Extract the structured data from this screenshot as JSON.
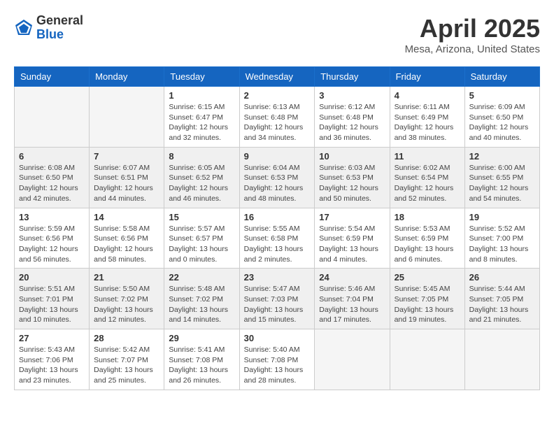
{
  "logo": {
    "general": "General",
    "blue": "Blue"
  },
  "header": {
    "title": "April 2025",
    "location": "Mesa, Arizona, United States"
  },
  "weekdays": [
    "Sunday",
    "Monday",
    "Tuesday",
    "Wednesday",
    "Thursday",
    "Friday",
    "Saturday"
  ],
  "weeks": [
    [
      {
        "day": "",
        "info": ""
      },
      {
        "day": "",
        "info": ""
      },
      {
        "day": "1",
        "info": "Sunrise: 6:15 AM\nSunset: 6:47 PM\nDaylight: 12 hours\nand 32 minutes."
      },
      {
        "day": "2",
        "info": "Sunrise: 6:13 AM\nSunset: 6:48 PM\nDaylight: 12 hours\nand 34 minutes."
      },
      {
        "day": "3",
        "info": "Sunrise: 6:12 AM\nSunset: 6:48 PM\nDaylight: 12 hours\nand 36 minutes."
      },
      {
        "day": "4",
        "info": "Sunrise: 6:11 AM\nSunset: 6:49 PM\nDaylight: 12 hours\nand 38 minutes."
      },
      {
        "day": "5",
        "info": "Sunrise: 6:09 AM\nSunset: 6:50 PM\nDaylight: 12 hours\nand 40 minutes."
      }
    ],
    [
      {
        "day": "6",
        "info": "Sunrise: 6:08 AM\nSunset: 6:50 PM\nDaylight: 12 hours\nand 42 minutes."
      },
      {
        "day": "7",
        "info": "Sunrise: 6:07 AM\nSunset: 6:51 PM\nDaylight: 12 hours\nand 44 minutes."
      },
      {
        "day": "8",
        "info": "Sunrise: 6:05 AM\nSunset: 6:52 PM\nDaylight: 12 hours\nand 46 minutes."
      },
      {
        "day": "9",
        "info": "Sunrise: 6:04 AM\nSunset: 6:53 PM\nDaylight: 12 hours\nand 48 minutes."
      },
      {
        "day": "10",
        "info": "Sunrise: 6:03 AM\nSunset: 6:53 PM\nDaylight: 12 hours\nand 50 minutes."
      },
      {
        "day": "11",
        "info": "Sunrise: 6:02 AM\nSunset: 6:54 PM\nDaylight: 12 hours\nand 52 minutes."
      },
      {
        "day": "12",
        "info": "Sunrise: 6:00 AM\nSunset: 6:55 PM\nDaylight: 12 hours\nand 54 minutes."
      }
    ],
    [
      {
        "day": "13",
        "info": "Sunrise: 5:59 AM\nSunset: 6:56 PM\nDaylight: 12 hours\nand 56 minutes."
      },
      {
        "day": "14",
        "info": "Sunrise: 5:58 AM\nSunset: 6:56 PM\nDaylight: 12 hours\nand 58 minutes."
      },
      {
        "day": "15",
        "info": "Sunrise: 5:57 AM\nSunset: 6:57 PM\nDaylight: 13 hours\nand 0 minutes."
      },
      {
        "day": "16",
        "info": "Sunrise: 5:55 AM\nSunset: 6:58 PM\nDaylight: 13 hours\nand 2 minutes."
      },
      {
        "day": "17",
        "info": "Sunrise: 5:54 AM\nSunset: 6:59 PM\nDaylight: 13 hours\nand 4 minutes."
      },
      {
        "day": "18",
        "info": "Sunrise: 5:53 AM\nSunset: 6:59 PM\nDaylight: 13 hours\nand 6 minutes."
      },
      {
        "day": "19",
        "info": "Sunrise: 5:52 AM\nSunset: 7:00 PM\nDaylight: 13 hours\nand 8 minutes."
      }
    ],
    [
      {
        "day": "20",
        "info": "Sunrise: 5:51 AM\nSunset: 7:01 PM\nDaylight: 13 hours\nand 10 minutes."
      },
      {
        "day": "21",
        "info": "Sunrise: 5:50 AM\nSunset: 7:02 PM\nDaylight: 13 hours\nand 12 minutes."
      },
      {
        "day": "22",
        "info": "Sunrise: 5:48 AM\nSunset: 7:02 PM\nDaylight: 13 hours\nand 14 minutes."
      },
      {
        "day": "23",
        "info": "Sunrise: 5:47 AM\nSunset: 7:03 PM\nDaylight: 13 hours\nand 15 minutes."
      },
      {
        "day": "24",
        "info": "Sunrise: 5:46 AM\nSunset: 7:04 PM\nDaylight: 13 hours\nand 17 minutes."
      },
      {
        "day": "25",
        "info": "Sunrise: 5:45 AM\nSunset: 7:05 PM\nDaylight: 13 hours\nand 19 minutes."
      },
      {
        "day": "26",
        "info": "Sunrise: 5:44 AM\nSunset: 7:05 PM\nDaylight: 13 hours\nand 21 minutes."
      }
    ],
    [
      {
        "day": "27",
        "info": "Sunrise: 5:43 AM\nSunset: 7:06 PM\nDaylight: 13 hours\nand 23 minutes."
      },
      {
        "day": "28",
        "info": "Sunrise: 5:42 AM\nSunset: 7:07 PM\nDaylight: 13 hours\nand 25 minutes."
      },
      {
        "day": "29",
        "info": "Sunrise: 5:41 AM\nSunset: 7:08 PM\nDaylight: 13 hours\nand 26 minutes."
      },
      {
        "day": "30",
        "info": "Sunrise: 5:40 AM\nSunset: 7:08 PM\nDaylight: 13 hours\nand 28 minutes."
      },
      {
        "day": "",
        "info": ""
      },
      {
        "day": "",
        "info": ""
      },
      {
        "day": "",
        "info": ""
      }
    ]
  ]
}
